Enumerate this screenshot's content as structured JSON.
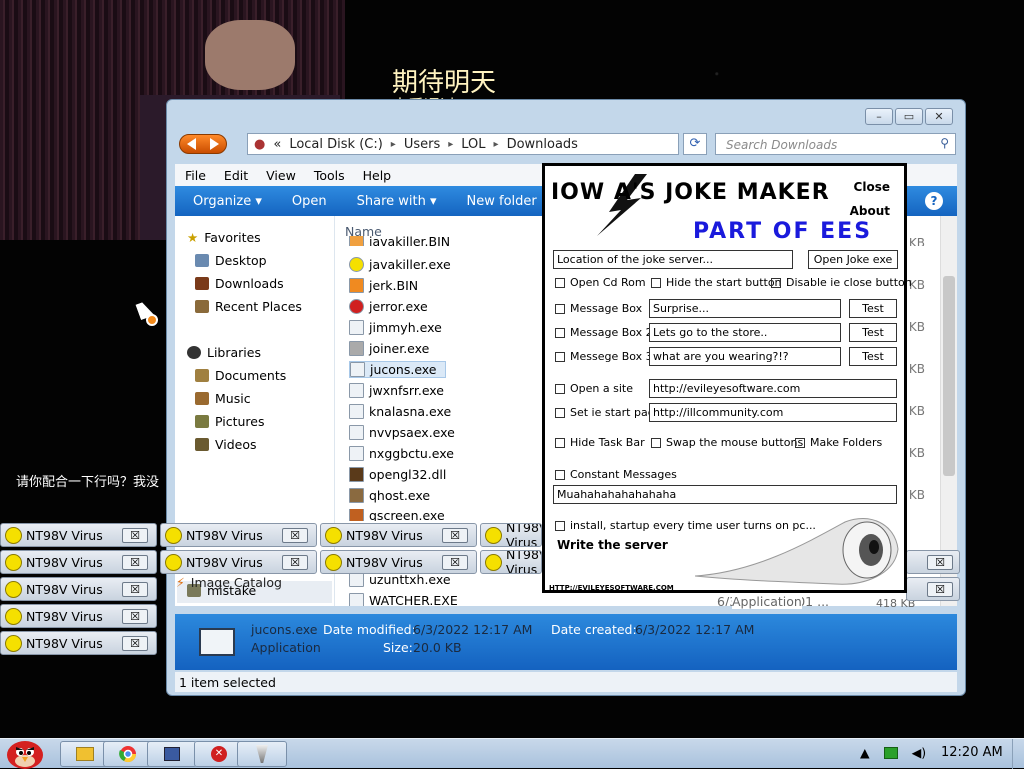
{
  "desktop": {
    "cjk_line1": "期待明天",
    "cjk_line2": "去爱通过",
    "cjk_line3": "请你配合一下行吗？我没"
  },
  "explorer": {
    "address": {
      "root_icon": "computer-icon",
      "chevron": "«",
      "crumbs": [
        "Local Disk (C:)",
        "Users",
        "LOL",
        "Downloads"
      ]
    },
    "search_placeholder": "Search Downloads",
    "menu": [
      "File",
      "Edit",
      "View",
      "Tools",
      "Help"
    ],
    "toolbar": [
      "Organize ▾",
      "Open",
      "Share with ▾",
      "New folder"
    ],
    "help_label": "?",
    "nav": {
      "favorites": "Favorites",
      "desktop": "Desktop",
      "downloads": "Downloads",
      "recent": "Recent Places",
      "libraries": "Libraries",
      "documents": "Documents",
      "music": "Music",
      "pictures": "Pictures",
      "videos": "Videos",
      "mistake": "mistake",
      "image_catalog": "Image Catalog"
    },
    "column_name": "Name",
    "files": [
      "javakiller.BIN",
      "javakiller.exe",
      "jerk.BIN",
      "jerror.exe",
      "jimmyh.exe",
      "joiner.exe",
      "jucons.exe",
      "jwxnfsrr.exe",
      "knalasna.exe",
      "nvvpsaex.exe",
      "nxggbctu.exe",
      "opengl32.dll",
      "qhost.exe",
      "qscreen.exe",
      "uzunttxh.exe",
      "WATCHER.EXE"
    ],
    "watcher_date": "6/3/2022 12:01 ...",
    "watcher_type": "Application",
    "watcher_size": "418 KB",
    "kb_label": "KB",
    "details": {
      "name": "jucons.exe",
      "modified_label": "Date modified:",
      "modified": "6/3/2022 12:17 AM",
      "created_label": "Date created:",
      "created": "6/3/2022 12:17 AM",
      "type": "Application",
      "size_label": "Size:",
      "size": "20.0 KB"
    },
    "status": "1 item selected"
  },
  "joke": {
    "title": "IOW  A'S JOKE MAKER",
    "subtitle": "PART OF EES",
    "close": "Close",
    "about": "About",
    "location_value": "Location of the joke server...",
    "open_joke": "Open Joke exe",
    "chk_open_cd": "Open Cd Rom",
    "chk_hide_start": "Hide the start button",
    "chk_disable_ie": "Disable ie close button",
    "mb1_label": "Message Box",
    "mb1_value": "Surprise...",
    "mb2_label": "Message Box 2",
    "mb2_value": "Lets go to the store..",
    "mb3_label": "Messege Box 3",
    "mb3_value": "what are you wearing?!?",
    "test": "Test",
    "open_site_label": "Open a site",
    "open_site_value": "http://evileyesoftware.com",
    "start_page_label": "Set ie start page",
    "start_page_value": "http://illcommunity.com",
    "chk_hide_taskbar": "Hide Task Bar",
    "chk_swap_mouse": "Swap the mouse buttons",
    "chk_make_folders": "Make Folders",
    "chk_constant": "Constant Messages",
    "constant_value": "Muahahahahahahaha",
    "chk_install": "install, startup every time user turns on pc...",
    "write_server": "Write the server",
    "url_footer": "HTTP://EVILEYESOFTWARE.COM"
  },
  "popups": {
    "label": "NT98V Virus",
    "close": "☒"
  },
  "taskbar": {
    "clock": "12:20 AM"
  }
}
